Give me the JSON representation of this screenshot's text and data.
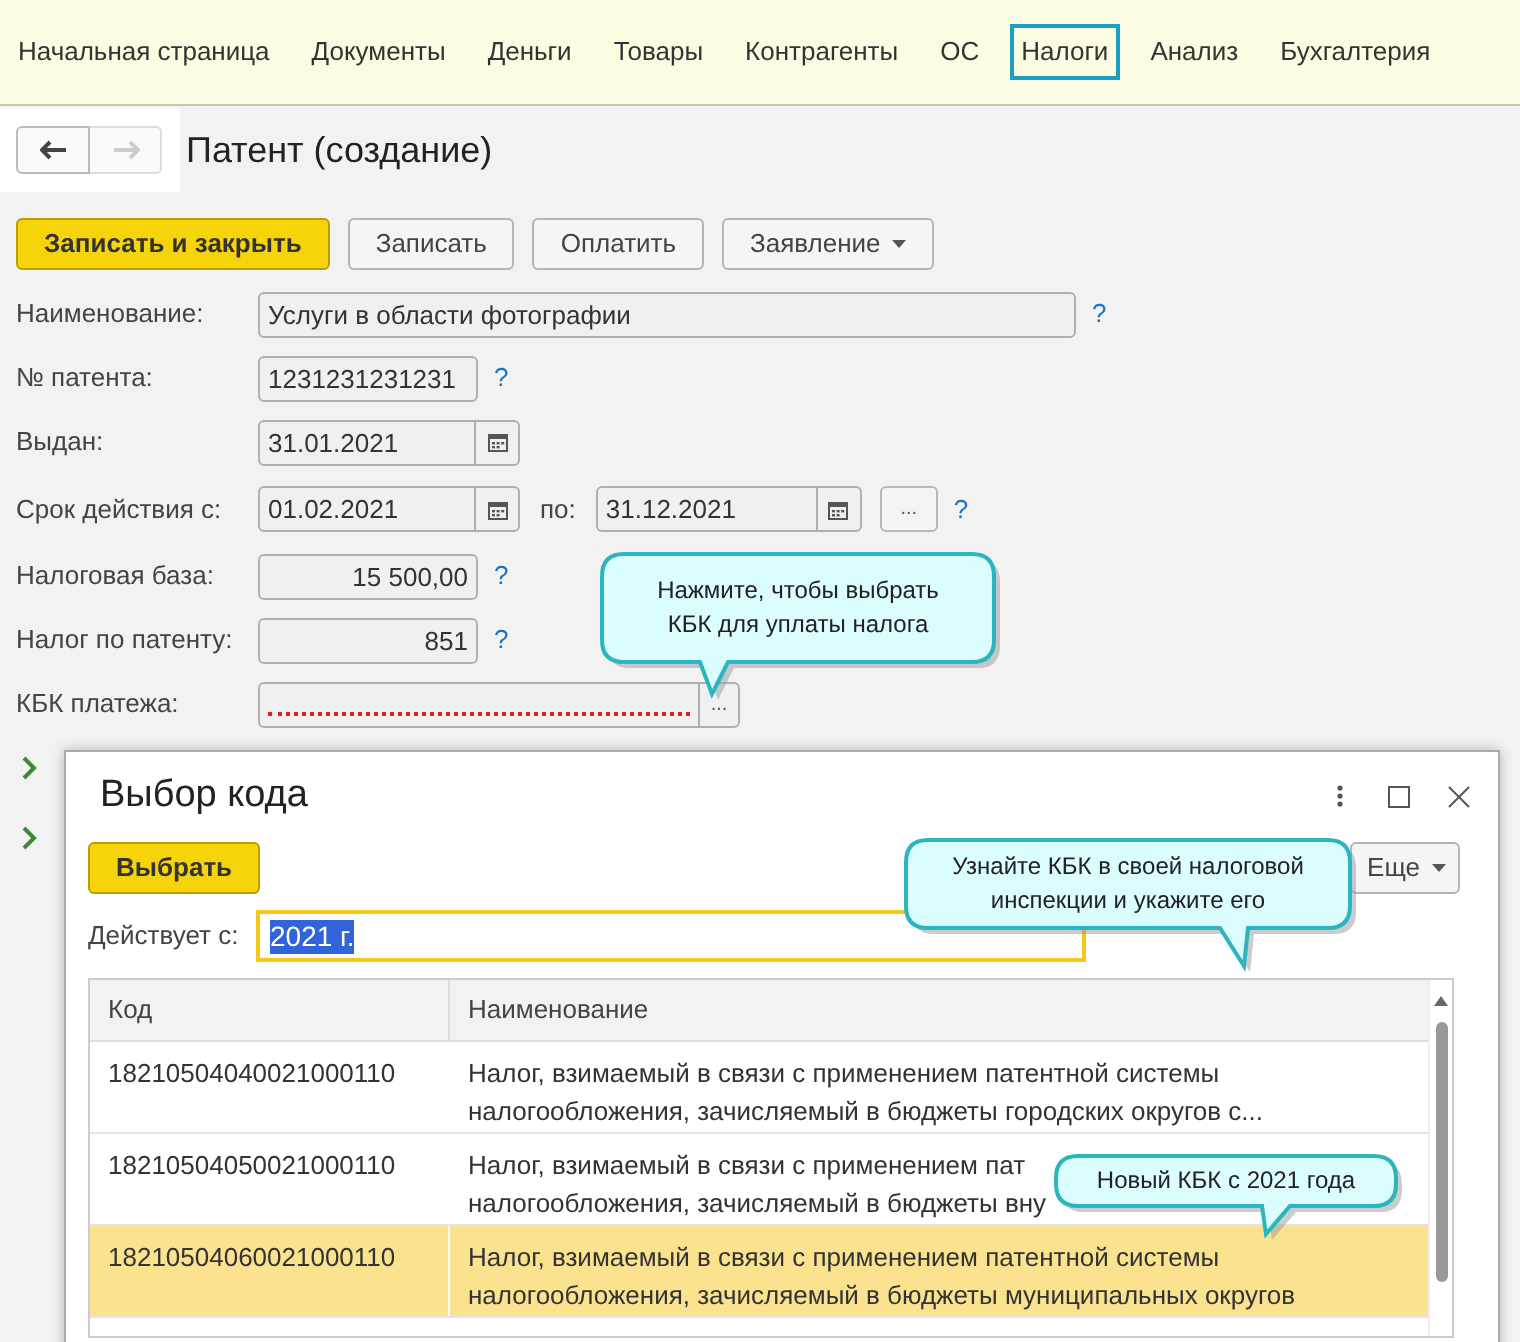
{
  "nav": [
    {
      "label": "Начальная страница",
      "selected": false
    },
    {
      "label": "Документы",
      "selected": false
    },
    {
      "label": "Деньги",
      "selected": false
    },
    {
      "label": "Товары",
      "selected": false
    },
    {
      "label": "Контрагенты",
      "selected": false
    },
    {
      "label": "ОС",
      "selected": false
    },
    {
      "label": "Налоги",
      "selected": true
    },
    {
      "label": "Анализ",
      "selected": false
    },
    {
      "label": "Бухгалтерия",
      "selected": false
    }
  ],
  "form": {
    "title": "Патент (создание)",
    "toolbar": [
      {
        "label": "Записать и закрыть",
        "kind": "primary"
      },
      {
        "label": "Записать",
        "kind": "plain"
      },
      {
        "label": "Оплатить",
        "kind": "plain"
      },
      {
        "label": "Заявление",
        "kind": "dropdown"
      }
    ],
    "fields": [
      {
        "kind": "text",
        "label": "Наименование:",
        "value": "Услуги в области фотографии",
        "help": "?"
      },
      {
        "kind": "code",
        "label": "№ патента:",
        "value": "1231231231231",
        "help": "?"
      },
      {
        "kind": "date",
        "label": "Выдан:",
        "value": "31.01.2021"
      },
      {
        "kind": "range",
        "label": "Срок действия с:",
        "value": "01.02.2021",
        "to_label": "по:",
        "to_value": "31.12.2021",
        "button": "...",
        "help": "?"
      },
      {
        "kind": "number",
        "label": "Налоговая база:",
        "value": "15 500,00",
        "help": "?"
      },
      {
        "kind": "number",
        "label": "Налог по патенту:",
        "value": "851",
        "help": "?"
      },
      {
        "kind": "select",
        "label": "КБК платежа:",
        "required": true,
        "button": "..."
      }
    ],
    "groups": [
      {
        "expanded": false
      },
      {
        "expanded": false
      }
    ]
  },
  "dialog": {
    "title": "Выбор кода",
    "choose_button": "Выбрать",
    "more_button": "Еще",
    "filter": {
      "label": "Действует с:",
      "value": "2021 г."
    },
    "columns": [
      "Код",
      "Наименование"
    ],
    "rows": [
      {
        "code": "18210504040021000110",
        "name_lines": [
          "Налог, взимаемый в связи с применением патентной системы",
          "налогообложения, зачисляемый в бюджеты городских округов с..."
        ],
        "selected": false
      },
      {
        "code": "18210504050021000110",
        "name_lines": [
          "Налог, взимаемый в связи с применением пат",
          "налогообложения, зачисляемый в бюджеты вну"
        ],
        "selected": false
      },
      {
        "code": "18210504060021000110",
        "name_lines": [
          "Налог, взимаемый в связи с применением патентной системы",
          "налогообложения, зачисляемый в бюджеты муниципальных округов"
        ],
        "selected": true
      }
    ]
  },
  "callouts": [
    {
      "text_lines": [
        "Нажмите, чтобы выбрать",
        "КБК для уплаты налога"
      ]
    },
    {
      "text_lines": [
        "Узнайте КБК в своей налоговой",
        "инспекции и укажите его"
      ]
    },
    {
      "text_lines": [
        "Новый КБК с 2021 года"
      ]
    }
  ]
}
